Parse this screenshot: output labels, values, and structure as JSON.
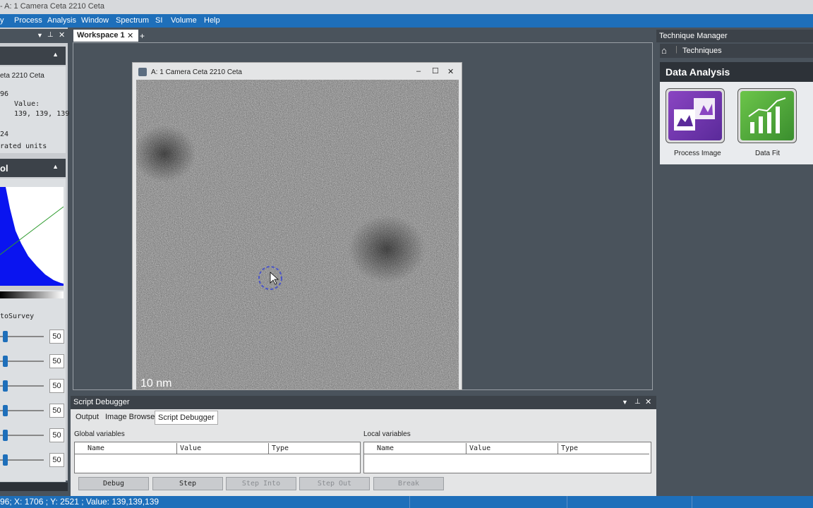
{
  "window": {
    "title": "- A: 1 Camera Ceta 2210 Ceta"
  },
  "menu": [
    "y",
    "Process",
    "Analysis",
    "Window",
    "Spectrum",
    "SI",
    "Volume",
    "Help"
  ],
  "left_panel": {
    "info_lines": [
      "eta 2210 Ceta",
      "96",
      "Value:",
      "139, 139, 139",
      "24",
      "rated units"
    ],
    "control_header": "ol",
    "survey_label": "toSurvey",
    "slider_values": [
      "50",
      "50",
      "50",
      "50",
      "50",
      "50"
    ]
  },
  "workspace": {
    "tab_label": "Workspace 1",
    "add_tab": "+"
  },
  "image_window": {
    "title": "A: 1 Camera Ceta 2210 Ceta",
    "scale_bar": "10 nm"
  },
  "technique_manager": {
    "title": "Technique Manager",
    "nav_label": "Techniques",
    "section_title": "Data Analysis",
    "tools": [
      {
        "label": "Process Image",
        "icon": "process-image-icon",
        "color": "#7b3fb5"
      },
      {
        "label": "Data Fit",
        "icon": "data-fit-icon",
        "color": "#4aa83a"
      }
    ]
  },
  "script_debugger": {
    "title": "Script Debugger",
    "tabs": [
      "Output",
      "Image Browser",
      "Script Debugger"
    ],
    "active_tab": "Script Debugger",
    "global_label": "Global variables",
    "local_label": "Local variables",
    "columns": [
      "Name",
      "Value",
      "Type"
    ],
    "buttons": [
      "Debug",
      "Step",
      "Step Into",
      "Step Out",
      "Break"
    ]
  },
  "status": {
    "text": "96;  X:  1706 ;  Y:  2521 ;  Value: 139,139,139"
  },
  "colors": {
    "menu_bar": "#1e6fba",
    "dark_panel": "#3c4249",
    "workspace_bg": "#4a535c"
  }
}
